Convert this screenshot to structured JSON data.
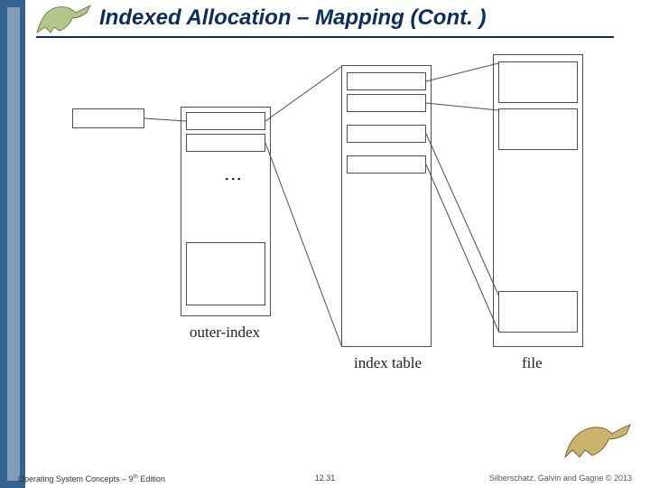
{
  "slide": {
    "title": "Indexed Allocation – Mapping (Cont. )",
    "page_number": "12.31",
    "footer_left_prefix": "Operating System Concepts – 9",
    "footer_left_suffix": " Edition",
    "footer_left_superscript": "th",
    "footer_right": "Silberschatz, Galvin and Gagne © 2013"
  },
  "diagram": {
    "labels": {
      "outer_index": "outer-index",
      "index_table": "index table",
      "file": "file"
    },
    "vdots": "⋮"
  },
  "icons": {
    "dino_small": "dinosaur-icon",
    "dino_large": "dinosaur-icon"
  }
}
